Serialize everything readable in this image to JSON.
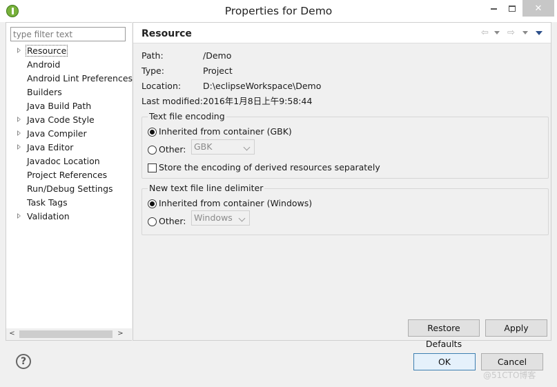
{
  "window": {
    "title": "Properties for Demo",
    "close_glyph": "✕",
    "accent_color": "#78b13b"
  },
  "sidebar": {
    "filter_placeholder": "type filter text",
    "items": [
      {
        "label": "Resource",
        "expandable": true,
        "selected": true
      },
      {
        "label": "Android",
        "expandable": false
      },
      {
        "label": "Android Lint Preferences",
        "expandable": false
      },
      {
        "label": "Builders",
        "expandable": false
      },
      {
        "label": "Java Build Path",
        "expandable": false
      },
      {
        "label": "Java Code Style",
        "expandable": true
      },
      {
        "label": "Java Compiler",
        "expandable": true
      },
      {
        "label": "Java Editor",
        "expandable": true
      },
      {
        "label": "Javadoc Location",
        "expandable": false
      },
      {
        "label": "Project References",
        "expandable": false
      },
      {
        "label": "Run/Debug Settings",
        "expandable": false
      },
      {
        "label": "Task Tags",
        "expandable": false
      },
      {
        "label": "Validation",
        "expandable": true
      }
    ],
    "scroll_left": "<",
    "scroll_right": ">"
  },
  "page": {
    "title": "Resource",
    "nav_back": "⇦",
    "nav_forward": "⇨",
    "info": [
      {
        "label": "Path:",
        "value": "/Demo"
      },
      {
        "label": "Type:",
        "value": "Project"
      },
      {
        "label": "Location:",
        "value": "D:\\eclipseWorkspace\\Demo"
      },
      {
        "label": "Last modified:",
        "value": "2016年1月8日上午9:58:44"
      }
    ],
    "encoding": {
      "legend": "Text file encoding",
      "inherited_label": "Inherited from container (GBK)",
      "other_label": "Other:",
      "other_value": "GBK",
      "store_label": "Store the encoding of derived resources separately",
      "selected": "inherited"
    },
    "delimiter": {
      "legend": "New text file line delimiter",
      "inherited_label": "Inherited from container (Windows)",
      "other_label": "Other:",
      "other_value": "Windows",
      "selected": "inherited"
    },
    "restore_label": "Restore Defaults",
    "apply_label": "Apply"
  },
  "footer": {
    "help_glyph": "?",
    "ok_label": "OK",
    "cancel_label": "Cancel",
    "watermark": "@51CTO博客"
  }
}
